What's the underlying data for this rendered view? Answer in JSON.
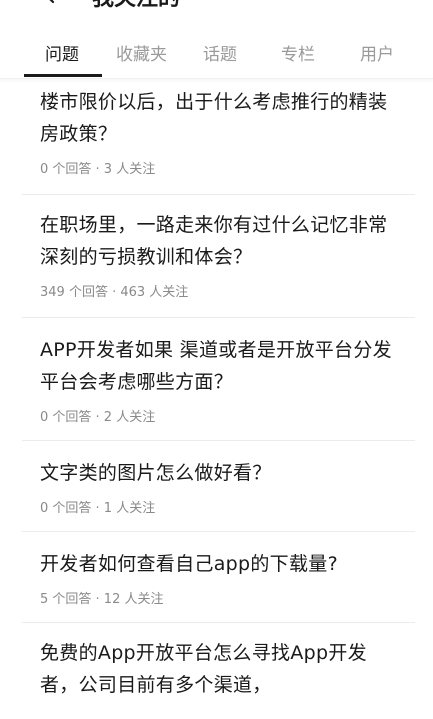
{
  "header": {
    "title": "我关注的",
    "back_icon": "chevron-left-icon"
  },
  "tabs": [
    {
      "label": "问题",
      "active": true
    },
    {
      "label": "收藏夹",
      "active": false
    },
    {
      "label": "话题",
      "active": false
    },
    {
      "label": "专栏",
      "active": false
    },
    {
      "label": "用户",
      "active": false
    }
  ],
  "questions": [
    {
      "title": "楼市限价以后，出于什么考虑推行的精装房政策？",
      "meta": "0 个回答 · 3 人关注"
    },
    {
      "title": "在职场里，一路走来你有过什么记忆非常深刻的亏损教训和体会？",
      "meta": "349 个回答 · 463 人关注"
    },
    {
      "title": "APP开发者如果 渠道或者是开放平台分发平台会考虑哪些方面？",
      "meta": "0 个回答 · 2 人关注"
    },
    {
      "title": "文字类的图片怎么做好看？",
      "meta": "0 个回答 · 1 人关注"
    },
    {
      "title": "开发者如何查看自己app的下载量?",
      "meta": "5 个回答 · 12 人关注"
    },
    {
      "title": "免费的App开放平台怎么寻找App开发者，公司目前有多个渠道，",
      "meta": ""
    }
  ],
  "colors": {
    "text_primary": "#1a1a1a",
    "text_secondary": "#8a8a8a",
    "tab_inactive": "#9a9a9a",
    "divider": "#ececec"
  }
}
